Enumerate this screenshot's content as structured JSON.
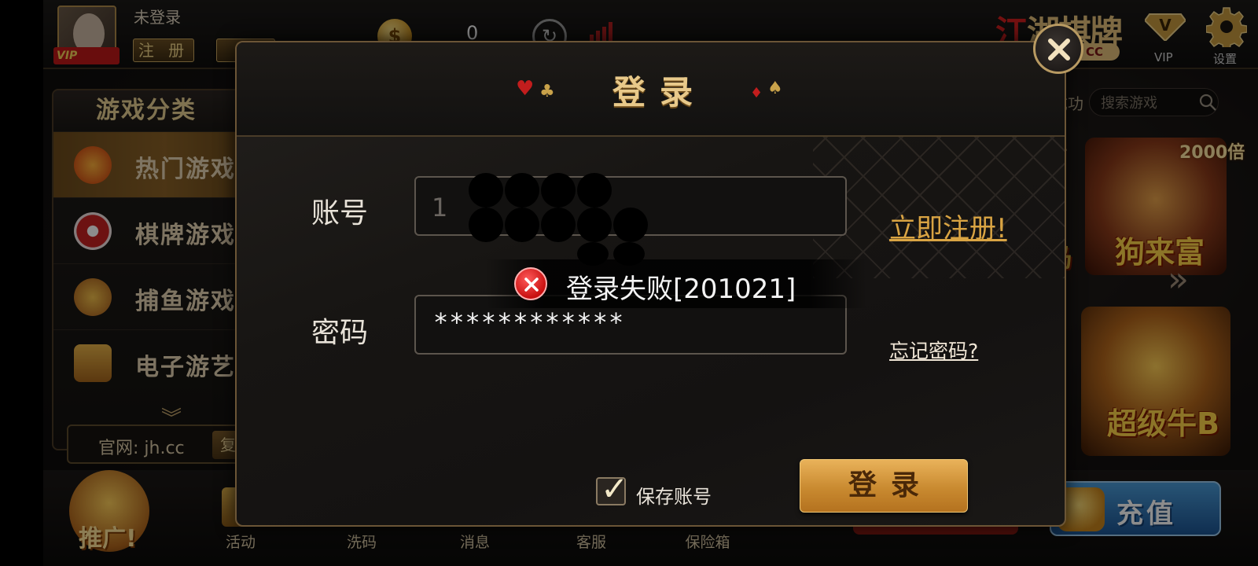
{
  "topbar": {
    "user_status": "未登录",
    "register_label": "注 册",
    "login_label": "登",
    "vip_badge": "VIP",
    "coin_symbol": "$",
    "coin_amount": "0",
    "brand_name_red": "江",
    "brand_name": "湖棋牌",
    "brand_sub": "CC",
    "vip_label": "VIP",
    "settings_label": "设置"
  },
  "categories": {
    "title": "游戏分类",
    "items": [
      {
        "label": "热门游戏",
        "icon": "hot-icon",
        "active": true
      },
      {
        "label": "棋牌游戏",
        "icon": "chip-icon",
        "active": false
      },
      {
        "label": "捕鱼游戏",
        "icon": "fish-icon",
        "active": false
      },
      {
        "label": "电子游艺",
        "icon": "slot-icon",
        "active": false
      }
    ],
    "more_icon": "︾"
  },
  "site": {
    "label": "官网: jh.cc",
    "copy_label": "复"
  },
  "games": {
    "search_prefix": "成功",
    "search_placeholder": "搜索游戏",
    "tiles": [
      {
        "name": "狗来富",
        "multiplier": "2000倍"
      },
      {
        "name": "超级牛B",
        "multiplier": ""
      }
    ],
    "partial_mult": "倍",
    "partial_name": "岛"
  },
  "bottom_nav": {
    "promo": "推广!",
    "items": [
      "活动",
      "洗码",
      "消息",
      "客服",
      "保险箱"
    ],
    "recharge": "充值"
  },
  "dialog": {
    "title": "登录",
    "account_label": "账号",
    "account_value": "1",
    "password_label": "密码",
    "password_value": "************",
    "register_link": "立即注册!",
    "forgot_link": "忘记密码?",
    "remember_label": "保存账号",
    "remember_checked": true,
    "login_button": "登录"
  },
  "toast": {
    "message": "登录失败[201021]",
    "type": "error"
  },
  "colors": {
    "accent_gold": "#e8c98a",
    "error_red": "#c80f0f",
    "link_orange": "#d9a443"
  }
}
